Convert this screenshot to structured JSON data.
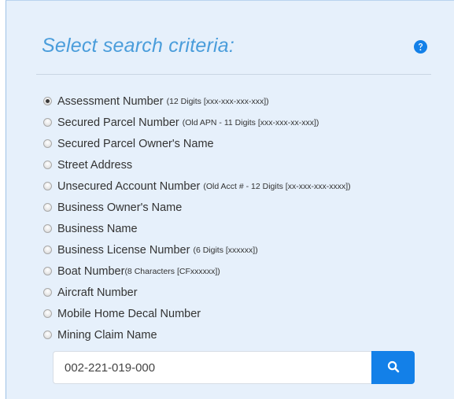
{
  "header": {
    "title": "Select search criteria:",
    "help_icon": "question-circle-icon",
    "accent_color": "#4a9ddb",
    "help_color": "#1380e8"
  },
  "options": [
    {
      "label": "Assessment Number",
      "note": "(12 Digits [xxx-xxx-xxx-xxx])",
      "checked": true
    },
    {
      "label": "Secured Parcel Number",
      "note": "(Old APN - 11 Digits [xxx-xxx-xx-xxx])",
      "checked": false
    },
    {
      "label": "Secured Parcel Owner's Name",
      "note": "",
      "checked": false
    },
    {
      "label": "Street Address",
      "note": "",
      "checked": false
    },
    {
      "label": "Unsecured Account Number",
      "note": "(Old Acct # - 12 Digits [xx-xxx-xxx-xxxx])",
      "checked": false
    },
    {
      "label": "Business Owner's Name",
      "note": "",
      "checked": false
    },
    {
      "label": "Business Name",
      "note": "",
      "checked": false
    },
    {
      "label": "Business License Number",
      "note": "(6 Digits [xxxxxx])",
      "checked": false
    },
    {
      "label": "Boat Number",
      "note": "(8 Characters [CFxxxxxx])",
      "checked": false
    },
    {
      "label": "Aircraft Number",
      "note": "",
      "checked": false
    },
    {
      "label": "Mobile Home Decal Number",
      "note": "",
      "checked": false
    },
    {
      "label": "Mining Claim Name",
      "note": "",
      "checked": false
    }
  ],
  "search": {
    "value": "002-221-019-000",
    "button_icon": "search-icon",
    "button_color": "#1380e8"
  }
}
